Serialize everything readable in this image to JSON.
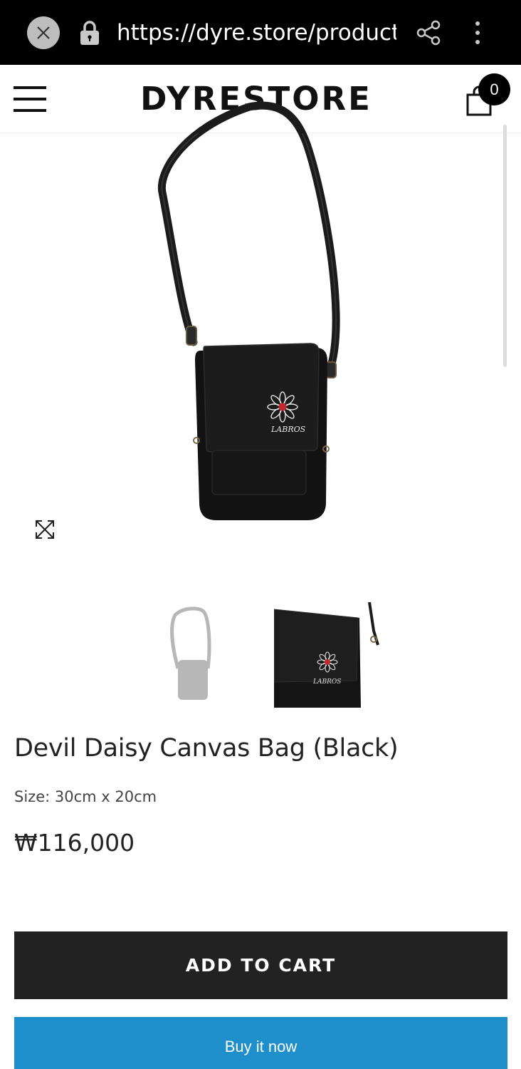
{
  "browser": {
    "url": "https://dyre.store/products/devil-daisy-canvas-bag-black",
    "icons": [
      "close-icon",
      "lock-icon",
      "share-icon",
      "more-vert-icon"
    ]
  },
  "header": {
    "logo": "DYRESTORE",
    "cart_count": "0",
    "icons": [
      "hamburger-menu-icon",
      "shopping-bag-icon"
    ]
  },
  "product": {
    "title": "Devil Daisy Canvas Bag (Black)",
    "size": "Size: 30cm x 20cm",
    "price": "₩116,000",
    "image_brand_mark": "LABROS",
    "thumbnail_count": 2,
    "selected_thumbnail": 1
  },
  "actions": {
    "add_to_cart": "ADD TO CART",
    "buy_now": "Buy it now"
  },
  "colors": {
    "browser_bar": "#000000",
    "add_to_cart_bg": "#222222",
    "buy_now_bg": "#1f8fcb",
    "flower_center": "#c0282d"
  }
}
